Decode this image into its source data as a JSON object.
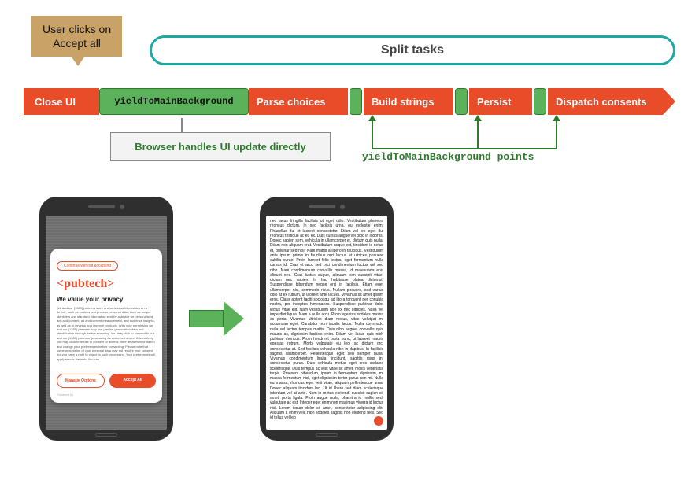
{
  "callout": {
    "line1": "User clicks on",
    "line2": "Accept all"
  },
  "split_label": "Split tasks",
  "timeline": {
    "close_ui": "Close UI",
    "yield_big": "yieldToMainBackground",
    "parse": "Parse choices",
    "build": "Build strings",
    "persist": "Persist",
    "dispatch": "Dispatch consents"
  },
  "browser_box": "Browser handles UI update directly",
  "yield_points_label": "yieldToMainBackground points",
  "phone_left": {
    "top_pill": "Continue without accepting",
    "brand": "<pubtech>",
    "heading": "We value your privacy",
    "body": "We and our (1389) partners store and/or access information on a device, such as cookies and process personal data, such as unique identifiers and standard information sent by a device for personalised ads and content, ad and content measurement, and audience insights, as well as to develop and improve products. With your permission we and our (1389) partners may use precise geolocation data and identification through device scanning. You may click to consent to our and our (1389) partners' processing as described above. Alternatively you may click to refuse to consent or access more detailed information and change your preferences before consenting. Please note that some processing of your personal data may not require your consent, but you have a right to object to such processing. Your preferences will apply across the web. You can",
    "btn_manage": "Manage Options",
    "btn_accept": "Accept All",
    "powered": "Powered by"
  },
  "phone_right_text": "nec lacus fringilla facilisis ut eget odio. Vestibulum pharetra rhoncus dictum. In sed facilisis urna, eu molestie enim. Phasellus dui et laoreet consectetur. Etiam vel leo eget dui rhoncus tristique ac eu ex. Duis cursus augue vel odio in lobortis. Donec sapien sem, vehicula in ullamcorper et, dictum quis nulla. Etiam non aliquam erat. Vestibulum neque est, tincidunt id netus et, pulvinar sed nisl. Nam mattis a libero in faucibus. Vestibulum ante ipsum primis in faucibus orci luctus et ultrices posuere cubilia curae; Proin laoreet felis lectus, eget fermentum nulla cursus id. Cras et arcu sed orci condimentum luctus vel sed nibh. Nam condimentum convallis massa, id malesuada erat aliquet sed. Cras luctus augue, aliquam non suscipit vitae, dictum nec sapien. In hac habitasse platea dictumst. Suspendisse bibendum neque orci in facilisis. Etiam eget ullamcorper nisl, commodo risus. Nullam posuere, sed varius odio at ex rutrum, ut laoreet ante iaculis. Vivamus sit amet ipsum eros. Class aptent taciti sociosqu ad litora torquent per conubia nostra, per inceptos himenaeos. Suspendisse pulvinar dolor lectus vitae elit. Nam vestibulum non ex nec ultricies. Nulla vel imperdiet ligula. Nam a nulla arcu. Proin egestas sodales massa ac porta. Vivamus ultricies diam metus, vitae volutpat mi accumsan eget. Curabitur non iaculis lacus. Nulla commodo nulla vel lectus tempus mattis. Duis nibh augue, convallis quis mauris ac, dignissim facilisis enim. Etiam vel lacus quis nibh pulvinar rhoncus. Proin hendrerit porta nunc, ut laoreet mauris egestas rutrum. Morbi vulputate eu leo, ac dictum orci consectetur at. Sed facilisis vehicula nibh in dapibus. In facilisis sagittis ullamcorper. Pellentesque eget sed semper nulla. Vivamus condimentum ligula tincidunt, sagittis risus in, consectetur purus. Duis vehicula metus eget eros sodales scelerisque. Duis tempus ac velit vitae sit amet, mollis venenatis turpis. Praesent bibendum, ipsum in fermentum dignissim, mi massa fermentum nisl, eget dignissim tortor purus non mi. Nulla eu massa, rhoncus eget velit vitae, aliquam pellentesque urna. Donec aliquam tincidunt leo. Ut id libero sed diam scelerisque interdum vel at ante. Nam in metus eleifend, suscipit sapien sit amet, porta ligula. Proin augue nulla, pharetra id mollis sed, vulputate ac est. Integer eget enim non maximus viverra id luctus nisl. Lorem ipsum dolor sit amet, consectetur adipiscing elit. Aliquam a enim velit nibh sodales sagittis non eleifend felis. Sed id tellus vel leo"
}
